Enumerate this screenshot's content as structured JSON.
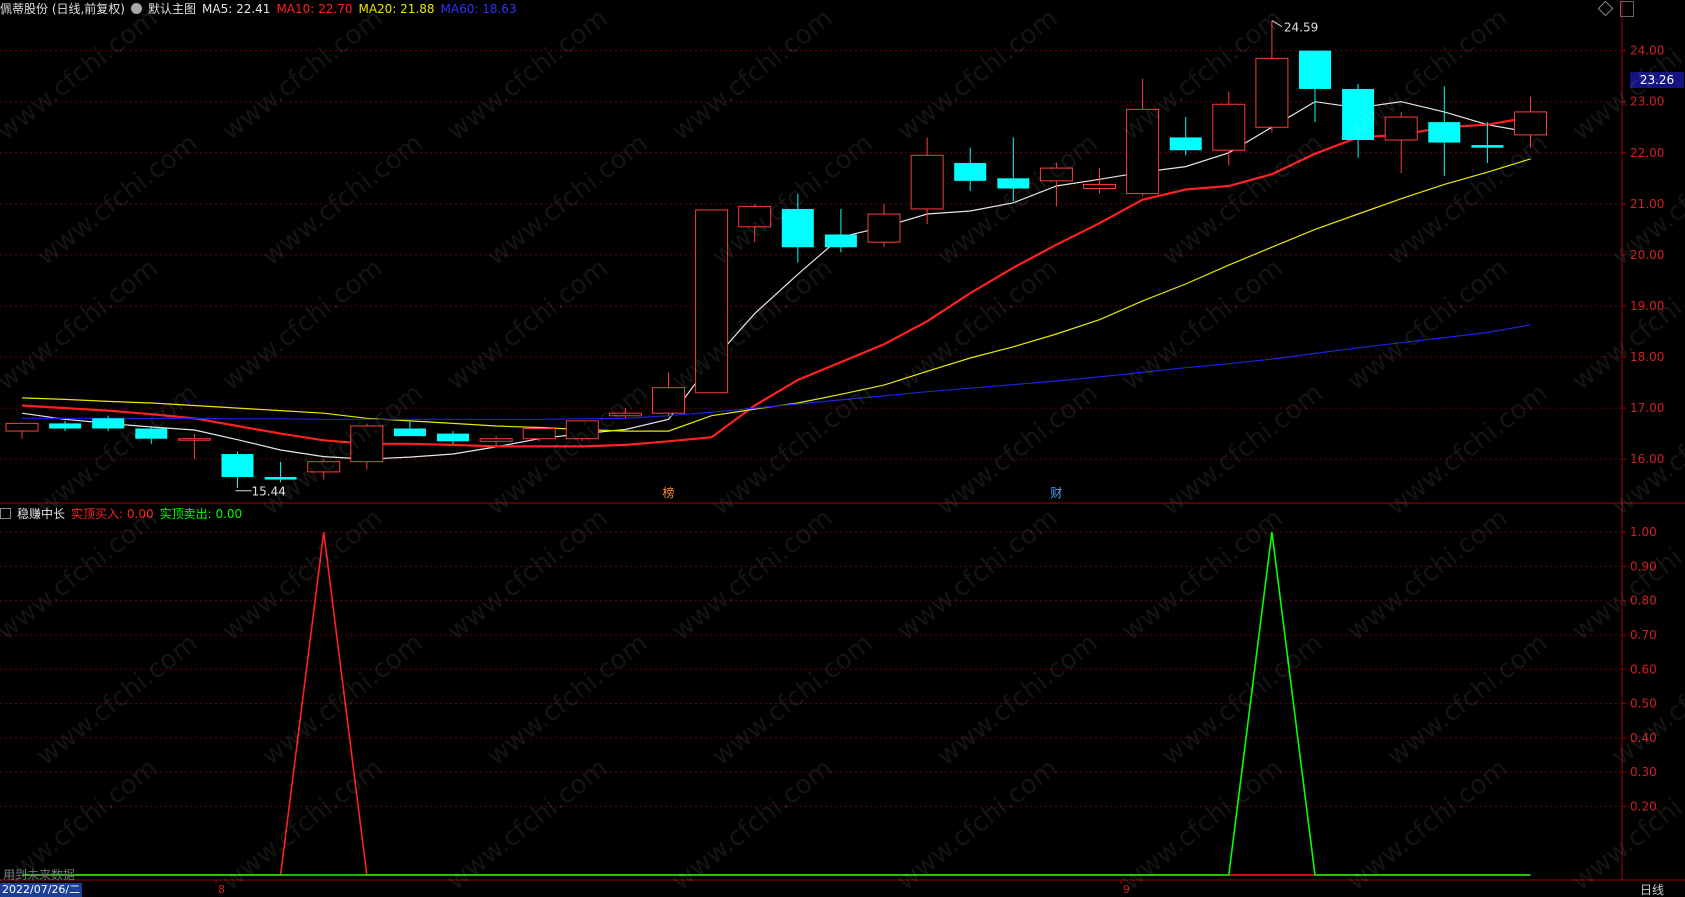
{
  "header": {
    "stock_title": "佩蒂股份 (日线,前复权)",
    "chart_name": "默认主图",
    "ma5": "MA5: 22.41",
    "ma10": "MA10: 22.70",
    "ma20": "MA20: 21.88",
    "ma60": "MA60: 18.63"
  },
  "indicator_header": {
    "name": "稳赚中长",
    "buy": "实顶买入: 0.00",
    "sell": "实顶卖出: 0.00"
  },
  "price_badge": "23.26",
  "high_label": "24.59",
  "low_label": "15.44",
  "event_markers": [
    "榜",
    "财"
  ],
  "future_note": "用到未来数据",
  "date_box": "2022/07/26/二",
  "month_labels": [
    "8",
    "9"
  ],
  "dayline_label": "日线",
  "watermark": "www.cfchi.com",
  "colors": {
    "up": "#ff3b3b",
    "down": "#00ffff",
    "ma5": "#e6e6e6",
    "ma10": "#ff2020",
    "ma20": "#e8e800",
    "ma60": "#2020e0",
    "buy": "#ff2020",
    "sell": "#00ff00",
    "axis": "#a00000",
    "grid": "#6b0000"
  },
  "chart_data": [
    {
      "type": "candlestick",
      "ylim": [
        15.2,
        24.6
      ],
      "y_ticks": [
        16.0,
        17.0,
        18.0,
        19.0,
        20.0,
        21.0,
        22.0,
        23.0,
        24.0
      ],
      "ohlc": [
        [
          16.55,
          16.72,
          16.4,
          16.7
        ],
        [
          16.7,
          16.75,
          16.55,
          16.6
        ],
        [
          16.8,
          16.85,
          16.55,
          16.6
        ],
        [
          16.6,
          16.65,
          16.3,
          16.4
        ],
        [
          16.4,
          16.5,
          16.0,
          16.4
        ],
        [
          16.1,
          16.15,
          15.44,
          15.65
        ],
        [
          15.65,
          15.95,
          15.55,
          15.6
        ],
        [
          15.75,
          16.0,
          15.6,
          15.95
        ],
        [
          15.95,
          16.7,
          15.8,
          16.65
        ],
        [
          16.6,
          16.75,
          16.45,
          16.45
        ],
        [
          16.5,
          16.55,
          16.3,
          16.35
        ],
        [
          16.35,
          16.45,
          16.25,
          16.4
        ],
        [
          16.4,
          16.65,
          16.35,
          16.6
        ],
        [
          16.4,
          16.75,
          16.35,
          16.75
        ],
        [
          16.85,
          17.0,
          16.8,
          16.9
        ],
        [
          16.9,
          17.7,
          16.85,
          17.4
        ],
        [
          17.3,
          20.88,
          18.6,
          20.88
        ],
        [
          20.55,
          21.0,
          20.25,
          20.95
        ],
        [
          20.9,
          21.2,
          19.85,
          20.15
        ],
        [
          20.4,
          20.9,
          20.05,
          20.15
        ],
        [
          20.25,
          21.0,
          20.15,
          20.8
        ],
        [
          20.9,
          22.3,
          20.6,
          21.95
        ],
        [
          21.8,
          22.1,
          21.25,
          21.45
        ],
        [
          21.5,
          22.3,
          21.05,
          21.3
        ],
        [
          21.45,
          21.8,
          20.95,
          21.7
        ],
        [
          21.3,
          21.7,
          21.2,
          21.38
        ],
        [
          21.2,
          23.45,
          21.15,
          22.85
        ],
        [
          22.3,
          22.7,
          21.95,
          22.05
        ],
        [
          22.05,
          23.2,
          21.75,
          22.95
        ],
        [
          22.5,
          24.59,
          22.4,
          23.85
        ],
        [
          24.0,
          24.0,
          22.6,
          23.25
        ],
        [
          23.25,
          23.35,
          21.9,
          22.25
        ],
        [
          22.25,
          22.8,
          21.6,
          22.7
        ],
        [
          22.6,
          23.3,
          21.55,
          22.2
        ],
        [
          22.15,
          22.6,
          21.8,
          22.1
        ],
        [
          22.35,
          23.1,
          22.1,
          22.8
        ]
      ],
      "series": [
        {
          "name": "MA5",
          "values": [
            16.9,
            16.78,
            16.7,
            16.63,
            16.57,
            16.38,
            16.18,
            16.05,
            16.0,
            16.04,
            16.1,
            16.24,
            16.4,
            16.5,
            16.58,
            16.78,
            17.9,
            18.85,
            19.62,
            20.35,
            20.55,
            20.8,
            20.86,
            21.02,
            21.35,
            21.48,
            21.62,
            21.73,
            22.0,
            22.5,
            23.0,
            22.88,
            23.0,
            22.8,
            22.55,
            22.4
          ]
        },
        {
          "name": "MA10",
          "values": [
            17.05,
            17.0,
            16.95,
            16.88,
            16.8,
            16.65,
            16.5,
            16.37,
            16.3,
            16.3,
            16.28,
            16.25,
            16.25,
            16.25,
            16.28,
            16.35,
            16.43,
            17.05,
            17.55,
            17.9,
            18.25,
            18.7,
            19.25,
            19.75,
            20.2,
            20.62,
            21.08,
            21.28,
            21.35,
            21.58,
            21.98,
            22.3,
            22.35,
            22.5,
            22.55,
            22.7
          ]
        },
        {
          "name": "MA20",
          "values": [
            17.2,
            17.17,
            17.13,
            17.1,
            17.05,
            17.0,
            16.95,
            16.9,
            16.8,
            16.75,
            16.7,
            16.65,
            16.62,
            16.58,
            16.55,
            16.55,
            16.85,
            16.98,
            17.1,
            17.27,
            17.45,
            17.72,
            17.98,
            18.2,
            18.45,
            18.73,
            19.1,
            19.43,
            19.8,
            20.15,
            20.5,
            20.8,
            21.1,
            21.38,
            21.62,
            21.88
          ]
        },
        {
          "name": "MA60",
          "values": [
            16.8,
            16.8,
            16.8,
            16.8,
            16.8,
            16.79,
            16.79,
            16.78,
            16.78,
            16.78,
            16.78,
            16.78,
            16.78,
            16.79,
            16.8,
            16.85,
            16.92,
            17.0,
            17.08,
            17.16,
            17.24,
            17.32,
            17.39,
            17.46,
            17.53,
            17.61,
            17.7,
            17.79,
            17.87,
            17.96,
            18.07,
            18.18,
            18.28,
            18.38,
            18.48,
            18.63
          ]
        }
      ]
    },
    {
      "type": "line",
      "ylim": [
        0,
        1.05
      ],
      "y_ticks": [
        0.2,
        0.3,
        0.4,
        0.5,
        0.6,
        0.7,
        0.8,
        0.9,
        1.0
      ],
      "series": [
        {
          "name": "实顶买入",
          "values": [
            0,
            0,
            0,
            0,
            0,
            0,
            0,
            1,
            0,
            0,
            0,
            0,
            0,
            0,
            0,
            0,
            0,
            0,
            0,
            0,
            0,
            0,
            0,
            0,
            0,
            0,
            0,
            0,
            0,
            0,
            0,
            0,
            0,
            0,
            0,
            0
          ]
        },
        {
          "name": "实顶卖出",
          "values": [
            0,
            0,
            0,
            0,
            0,
            0,
            0,
            0,
            0,
            0,
            0,
            0,
            0,
            0,
            0,
            0,
            0,
            0,
            0,
            0,
            0,
            0,
            0,
            0,
            0,
            0,
            0,
            0,
            0,
            1,
            0,
            0,
            0,
            0,
            0,
            0
          ]
        }
      ]
    }
  ]
}
